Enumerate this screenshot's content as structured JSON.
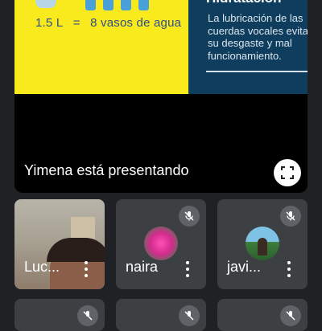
{
  "presentation": {
    "equation": {
      "volume": "1.5 L",
      "equals": "=",
      "result": "8 vasos de agua"
    },
    "hydration": {
      "title": "Hidratación",
      "text": "La lubricación de las cuerdas vocales evita su desgaste y mal funcionamiento."
    },
    "presenter_text": "Yimena está presentando",
    "fullscreen_icon": "fullscreen-icon"
  },
  "participants": [
    {
      "name": "Luc...",
      "video": true
    },
    {
      "name": "naira",
      "muted": true,
      "avatar": "flower"
    },
    {
      "name": "javi...",
      "muted": true,
      "avatar": "photo"
    }
  ],
  "colors": {
    "background": "#202124",
    "tile": "#3c4043",
    "slide_yellow": "#f8ea1c",
    "slide_blue": "#0f3d5e"
  }
}
